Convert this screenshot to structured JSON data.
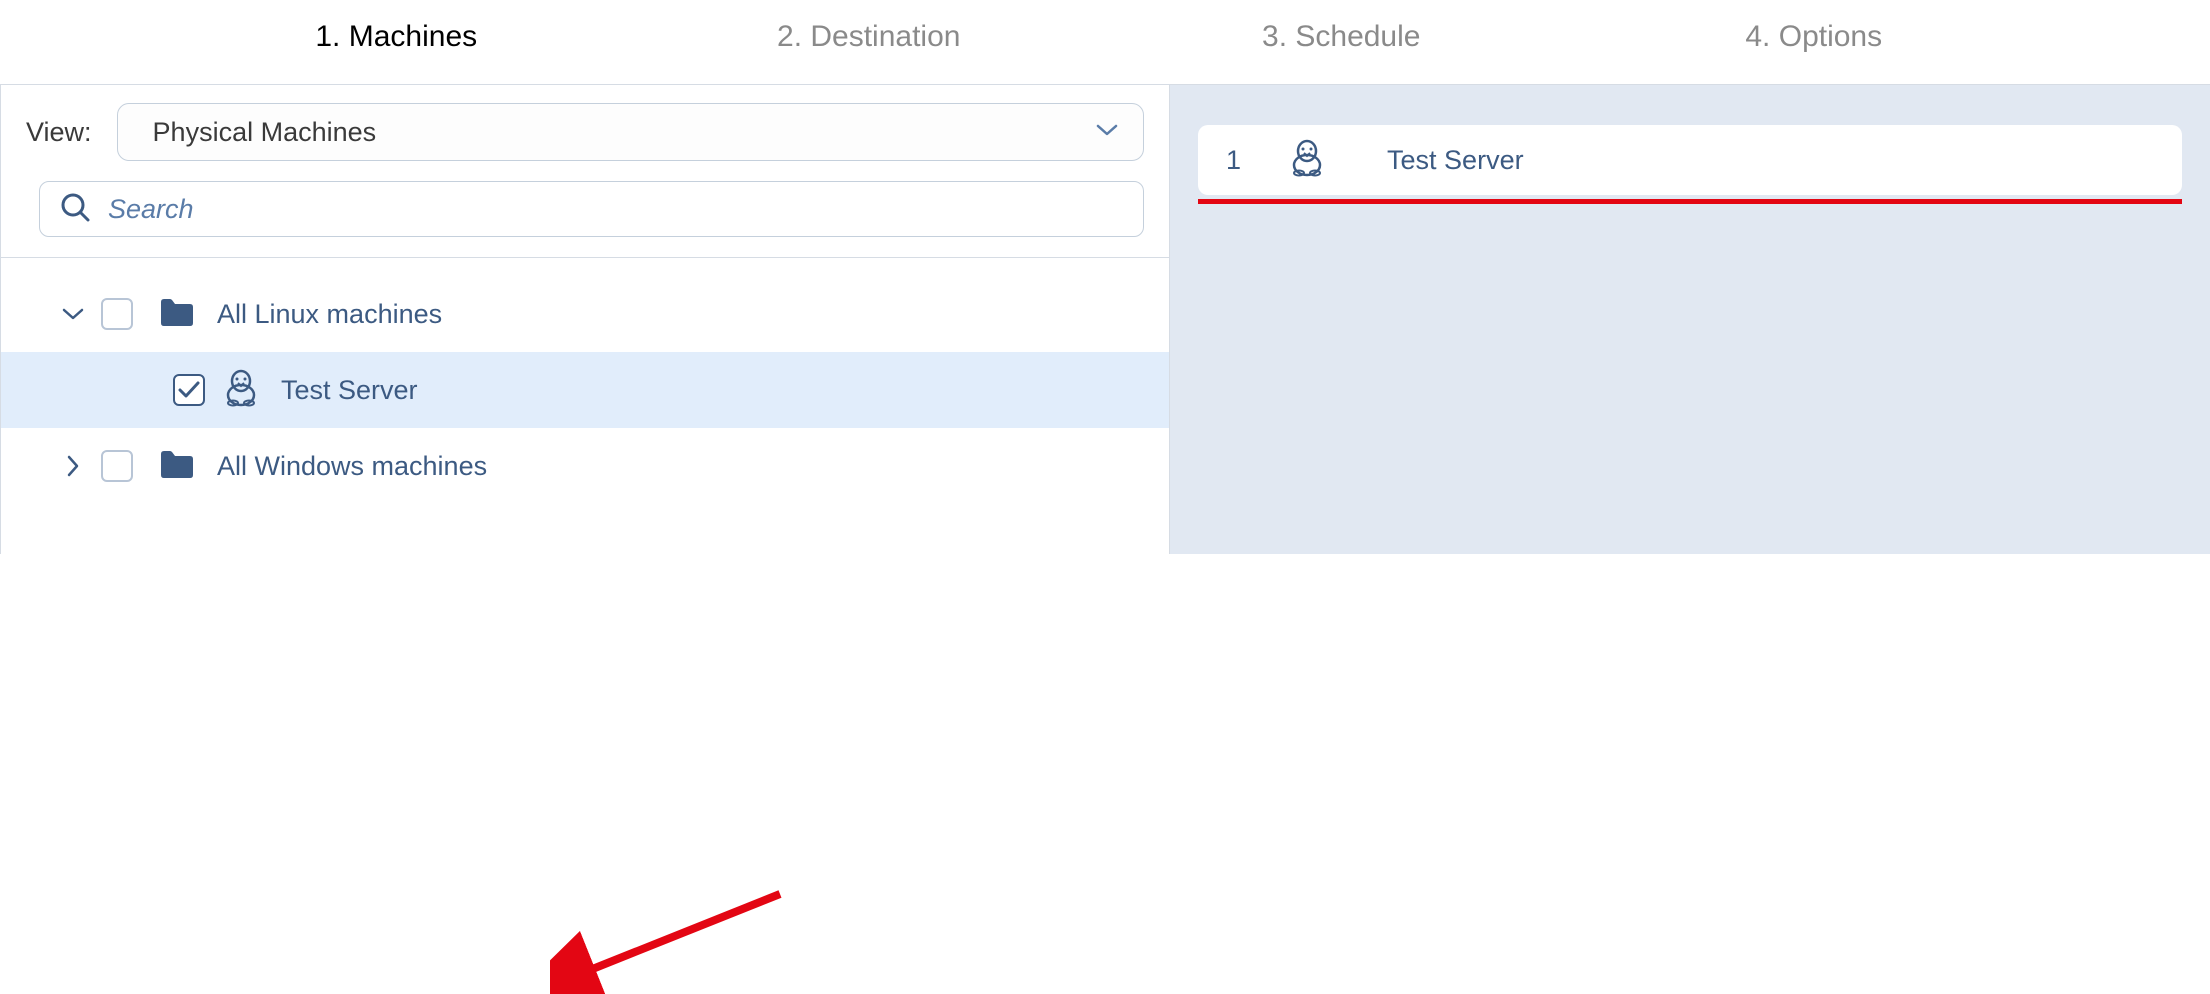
{
  "wizard": {
    "steps": [
      {
        "label": "1. Machines",
        "active": true
      },
      {
        "label": "2. Destination",
        "active": false
      },
      {
        "label": "3. Schedule",
        "active": false
      },
      {
        "label": "4. Options",
        "active": false
      }
    ]
  },
  "view": {
    "label": "View:",
    "selected": "Physical Machines"
  },
  "search": {
    "placeholder": "Search"
  },
  "tree": {
    "items": [
      {
        "label": "All Linux machines",
        "type": "folder",
        "expanded": true,
        "checked": false,
        "depth": 0
      },
      {
        "label": "Test Server",
        "type": "machine",
        "checked": true,
        "depth": 1,
        "selected": true
      },
      {
        "label": "All Windows machines",
        "type": "folder",
        "expanded": false,
        "checked": false,
        "depth": 0
      }
    ]
  },
  "selected": {
    "items": [
      {
        "index": "1",
        "label": "Test Server"
      }
    ]
  },
  "colors": {
    "text_primary": "#3c5a82",
    "text_muted": "#8a8a8a",
    "bg_selected": "#e1edfb",
    "bg_right": "#e1e8f2",
    "border": "#d6dce4",
    "accent_red": "#e30613"
  }
}
